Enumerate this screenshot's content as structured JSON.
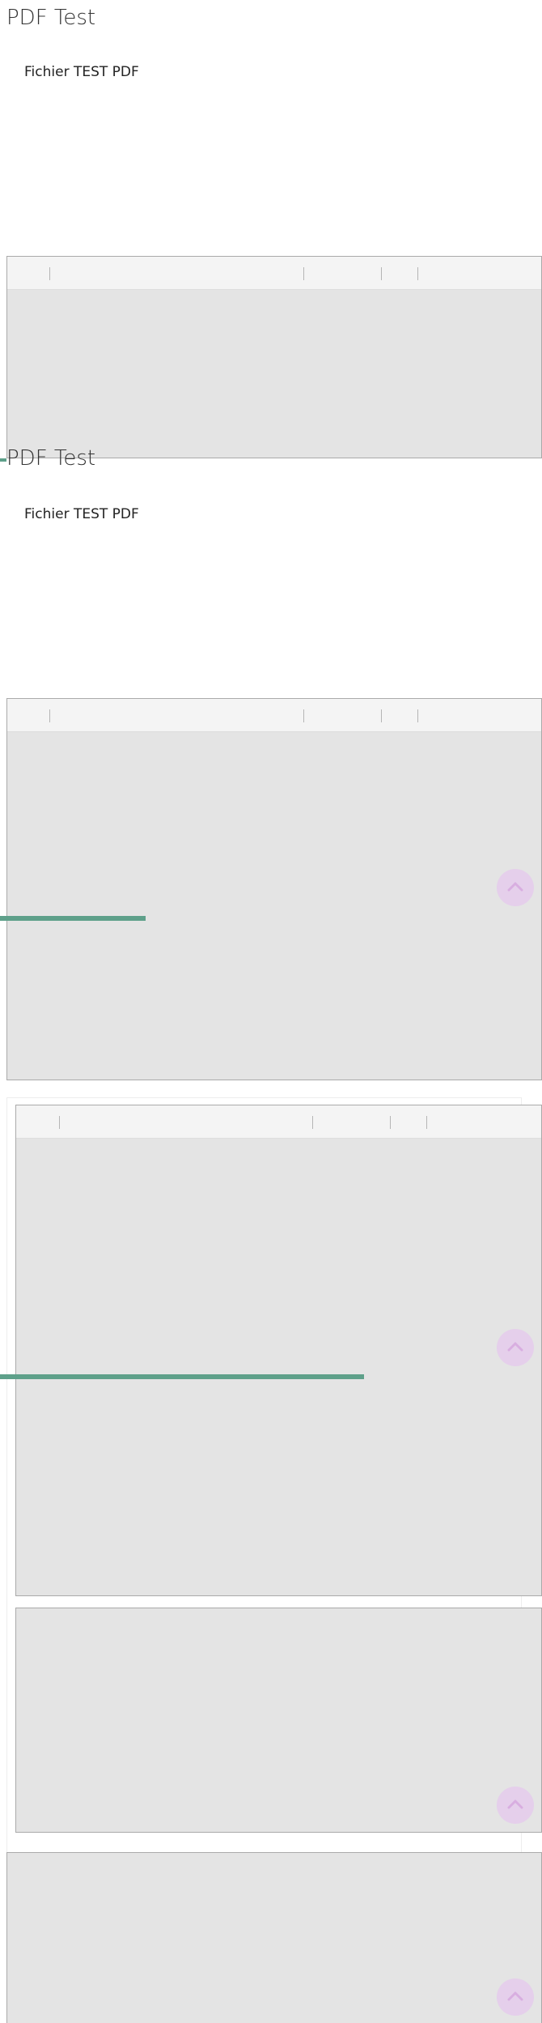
{
  "blocks": [
    {
      "title": "PDF Test",
      "description": "Fichier TEST PDF"
    },
    {
      "title": "PDF Test",
      "description": "Fichier TEST PDF"
    }
  ],
  "colors": {
    "viewer_bg": "#e4e4e4",
    "toolbar_bg": "#f4f4f4",
    "progress": "#5ea08a",
    "scroll_button": "#e6bef0"
  },
  "icons": {
    "scroll_top": "chevron-up-icon"
  }
}
